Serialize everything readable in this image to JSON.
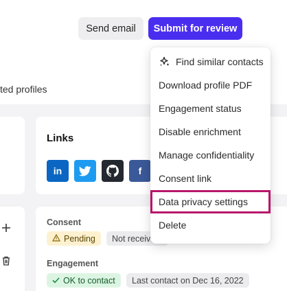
{
  "header": {
    "send_email_label": "Send email",
    "submit_label": "Submit for review",
    "tab_partial_label": "ted profiles"
  },
  "links_card": {
    "title": "Links",
    "socials": [
      {
        "name": "linkedin",
        "glyph": "in"
      },
      {
        "name": "twitter",
        "glyph": ""
      },
      {
        "name": "github",
        "glyph": ""
      },
      {
        "name": "facebook",
        "glyph": "f"
      }
    ]
  },
  "consent_card": {
    "consent_label": "Consent",
    "pending_label": "Pending",
    "not_receiving_label": "Not receiving",
    "engagement_label": "Engagement",
    "ok_label": "OK to contact",
    "last_contact_label": "Last contact on Dec 16, 2022"
  },
  "menu": {
    "items": [
      {
        "label": "Find similar contacts",
        "icon": "sparkle-icon"
      },
      {
        "label": "Download profile PDF"
      },
      {
        "label": "Engagement status"
      },
      {
        "label": "Disable enrichment"
      },
      {
        "label": "Manage confidentiality"
      },
      {
        "label": "Consent link"
      },
      {
        "label": "Data privacy settings",
        "highlighted": true
      },
      {
        "label": "Delete"
      }
    ]
  },
  "colors": {
    "primary": "#4a2ef0",
    "highlight_border": "#b8156a"
  }
}
